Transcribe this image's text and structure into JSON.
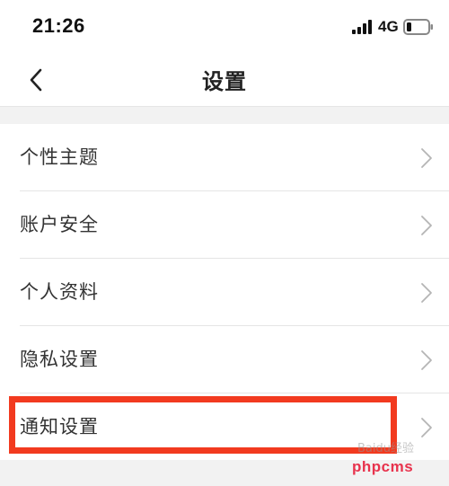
{
  "status_bar": {
    "time": "21:26",
    "network": "4G",
    "signal_icon": "signal-bars-icon",
    "battery_icon": "battery-low-icon"
  },
  "nav": {
    "title": "设置",
    "back_icon": "chevron-left-icon"
  },
  "settings": {
    "items": [
      {
        "label": "个性主题"
      },
      {
        "label": "账户安全"
      },
      {
        "label": "个人资料"
      },
      {
        "label": "隐私设置"
      },
      {
        "label": "通知设置"
      }
    ]
  },
  "annotation": {
    "highlighted_item": "通知设置",
    "highlight_color": "#f23a1f"
  },
  "watermark": {
    "brand": "Baidu经验",
    "site": "phpcms"
  },
  "colors": {
    "background": "#ffffff",
    "separator": "#f2f2f2",
    "text": "#333333",
    "chevron": "#b5b5b5"
  }
}
